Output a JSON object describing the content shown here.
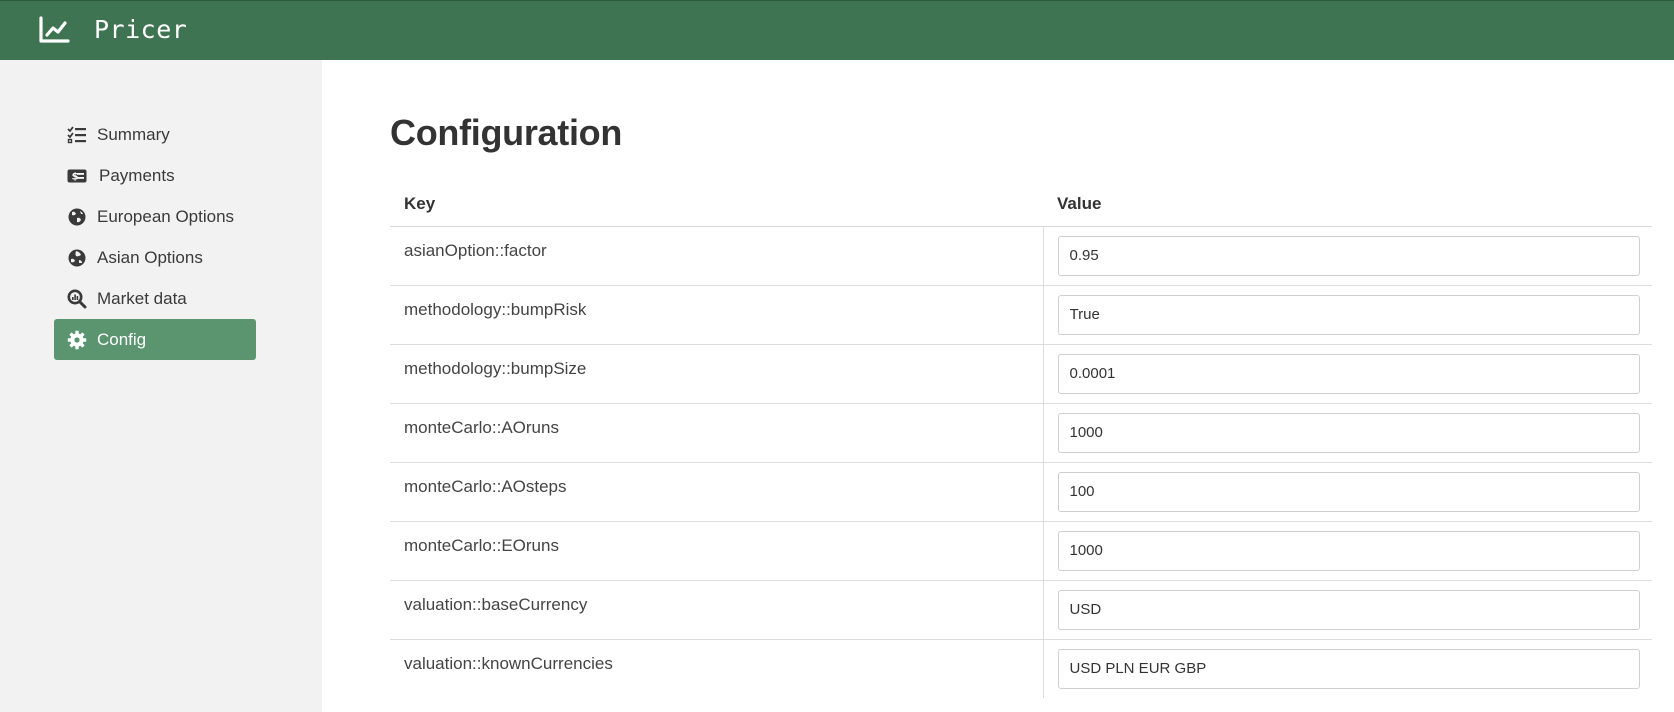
{
  "app": {
    "title": "Pricer",
    "logo_icon": "chart-line-icon",
    "brand_color": "#3e7452"
  },
  "sidebar": {
    "items": [
      {
        "label": "Summary",
        "icon": "list-check-icon",
        "active": false
      },
      {
        "label": "Payments",
        "icon": "money-bill-icon",
        "active": false
      },
      {
        "label": "European Options",
        "icon": "globe-europe-icon",
        "active": false
      },
      {
        "label": "Asian Options",
        "icon": "globe-asia-icon",
        "active": false
      },
      {
        "label": "Market data",
        "icon": "search-chart-icon",
        "active": false
      },
      {
        "label": "Config",
        "icon": "gear-icon",
        "active": true
      }
    ],
    "active_color": "#5a9570"
  },
  "main": {
    "title": "Configuration",
    "table": {
      "headers": {
        "key": "Key",
        "value": "Value"
      },
      "rows": [
        {
          "key": "asianOption::factor",
          "value": "0.95"
        },
        {
          "key": "methodology::bumpRisk",
          "value": "True"
        },
        {
          "key": "methodology::bumpSize",
          "value": "0.0001"
        },
        {
          "key": "monteCarlo::AOruns",
          "value": "1000"
        },
        {
          "key": "monteCarlo::AOsteps",
          "value": "100"
        },
        {
          "key": "monteCarlo::EOruns",
          "value": "1000"
        },
        {
          "key": "valuation::baseCurrency",
          "value": "USD"
        },
        {
          "key": "valuation::knownCurrencies",
          "value": "USD PLN EUR GBP"
        }
      ]
    }
  }
}
